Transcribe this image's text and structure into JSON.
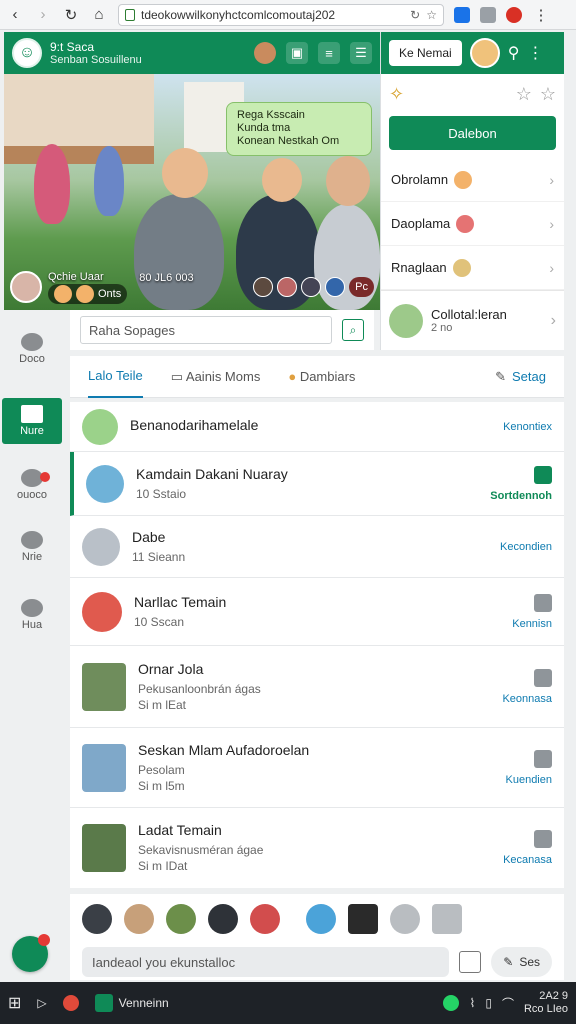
{
  "browser": {
    "url": "tdeokowwilkonyhctcomlcomoutaj202",
    "back_icon": "chevron-left-icon",
    "forward_icon": "chevron-right-icon"
  },
  "header": {
    "title": "9:t Saca",
    "subtitle": "Senban Sosuillenu"
  },
  "video": {
    "bubble_line1": "Rega Ksscain",
    "bubble_line2": "Kunda tma",
    "bubble_line3": "Konean Nestkah",
    "bubble_tail": "Om",
    "caption_name": "Qchie Uaar",
    "caption_time": "80 JL6 003",
    "pill_label": "Onts",
    "end_label": "Pc"
  },
  "right_panel": {
    "top_button": "Ke Nemai",
    "primary_button": "Dalebon",
    "items": [
      {
        "label": "Obrolamn"
      },
      {
        "label": "Daoplama"
      },
      {
        "label": "Rnaglaan"
      }
    ],
    "contact_name": "Collotal:leran",
    "contact_sub": "2 no"
  },
  "search": {
    "placeholder": "Raha Sopages"
  },
  "tabs": {
    "items": [
      "Lalo Teile",
      "Aainis Moms",
      "Dambiars"
    ],
    "right_label": "Setag"
  },
  "leftnav": {
    "items": [
      "Doco",
      "Nure",
      "ouoco",
      "Nrie",
      "Hua"
    ]
  },
  "chats": [
    {
      "name": "Benanodarihamelale",
      "sub": "",
      "action": "Kenontiex"
    },
    {
      "name": "Kamdain Dakani Nuaray",
      "sub": "10 Sstaio",
      "action": "Sortdennoh"
    },
    {
      "name": "Dabe",
      "sub": "11 Sieann",
      "action": "Kecondien"
    },
    {
      "name": "Narllac Temain",
      "sub": "10 Sscan",
      "action": "Kennisn"
    },
    {
      "name": "Ornar Jola",
      "sub": "Pekusanloonbrán ágas",
      "sub2": "Si m lEat",
      "action": "Keonnasa"
    },
    {
      "name": "Seskan Mlam Aufadoroelan",
      "sub": "Pesolam",
      "sub2": "Si m l5m",
      "action": "Kuendien"
    },
    {
      "name": "Ladat Temain",
      "sub": "Sekavisnusméran ágae",
      "sub2": "Si m IDat",
      "action": "Kecanasa"
    }
  ],
  "composer": {
    "placeholder": "Iandeaol you ekunstalloc",
    "send_label": "Ses"
  },
  "taskbar": {
    "app_label": "Venneinn",
    "clock_line1": "2A2 9",
    "clock_line2": "Rco LIeo"
  }
}
